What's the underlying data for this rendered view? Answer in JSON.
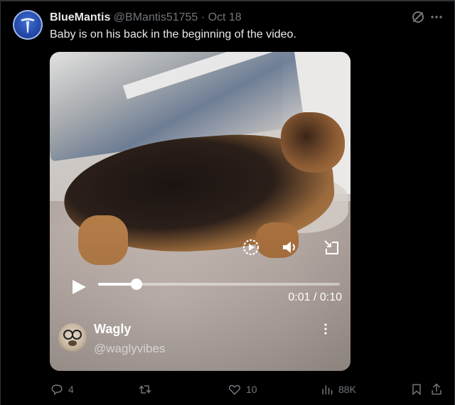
{
  "tweet": {
    "display_name": "BlueMantis",
    "handle": "@BMantis51755",
    "separator": "·",
    "date": "Oct 18",
    "text": "Baby is on his back in the beginning of the video."
  },
  "video": {
    "current_time": "0:01",
    "duration": "0:10",
    "time_label": "0:01 / 0:10",
    "progress_percent": 16,
    "source_name": "Wagly",
    "source_handle": "@waglyvibes"
  },
  "actions": {
    "replies": "4",
    "retweets": "",
    "likes": "10",
    "views": "88K"
  },
  "icons": {
    "more": "more-icon",
    "grok": "grok-icon",
    "play": "play-icon",
    "replay": "replay-icon",
    "volume": "volume-icon",
    "pip": "pip-icon",
    "reply": "reply-icon",
    "retweet": "retweet-icon",
    "like": "heart-icon",
    "views": "views-icon",
    "bookmark": "bookmark-icon",
    "share": "share-icon"
  },
  "colors": {
    "background": "#000000",
    "text_primary": "#e7e9ea",
    "text_secondary": "#71767b",
    "accent": "#1d9bf0"
  }
}
